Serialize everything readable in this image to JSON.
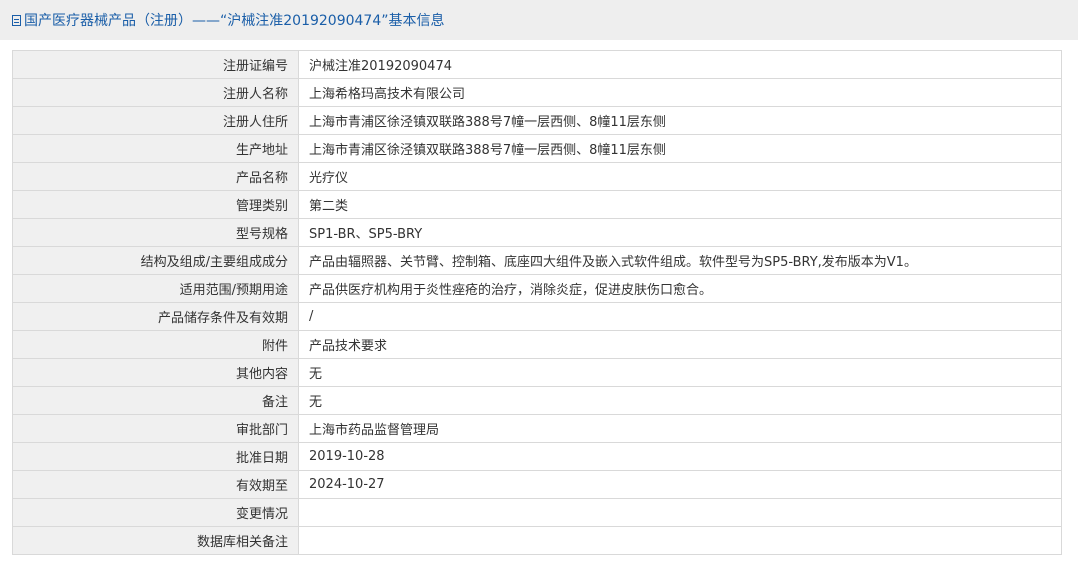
{
  "header": {
    "title": "国产医疗器械产品（注册）——“沪械注准20192090474”基本信息",
    "icon": "document-icon"
  },
  "rows": [
    {
      "name": "registration-number",
      "label": "注册证编号",
      "value": "沪械注准20192090474"
    },
    {
      "name": "registrant-name",
      "label": "注册人名称",
      "value": "上海希格玛高技术有限公司"
    },
    {
      "name": "registrant-address",
      "label": "注册人住所",
      "value": "上海市青浦区徐泾镇双联路388号7幢一层西侧、8幢11层东侧"
    },
    {
      "name": "production-address",
      "label": "生产地址",
      "value": "上海市青浦区徐泾镇双联路388号7幢一层西侧、8幢11层东侧"
    },
    {
      "name": "product-name",
      "label": "产品名称",
      "value": "光疗仪"
    },
    {
      "name": "management-category",
      "label": "管理类别",
      "value": "第二类"
    },
    {
      "name": "model-spec",
      "label": "型号规格",
      "value": "SP1-BR、SP5-BRY"
    },
    {
      "name": "structure-composition",
      "label": "结构及组成/主要组成成分",
      "value": "产品由辐照器、关节臂、控制箱、底座四大组件及嵌入式软件组成。软件型号为SP5-BRY,发布版本为V1。"
    },
    {
      "name": "scope-of-use",
      "label": "适用范围/预期用途",
      "value": "产品供医疗机构用于炎性痤疮的治疗，消除炎症，促进皮肤伤口愈合。"
    },
    {
      "name": "storage-validity",
      "label": "产品储存条件及有效期",
      "value": "/"
    },
    {
      "name": "attachment",
      "label": "附件",
      "value": "产品技术要求"
    },
    {
      "name": "other-content",
      "label": "其他内容",
      "value": "无"
    },
    {
      "name": "remarks",
      "label": "备注",
      "value": "无"
    },
    {
      "name": "approval-department",
      "label": "审批部门",
      "value": "上海市药品监督管理局"
    },
    {
      "name": "approval-date",
      "label": "批准日期",
      "value": "2019-10-28"
    },
    {
      "name": "valid-until",
      "label": "有效期至",
      "value": "2024-10-27"
    },
    {
      "name": "change-status",
      "label": "变更情况",
      "value": ""
    },
    {
      "name": "database-notes",
      "label": "数据库相关备注",
      "value": ""
    }
  ]
}
